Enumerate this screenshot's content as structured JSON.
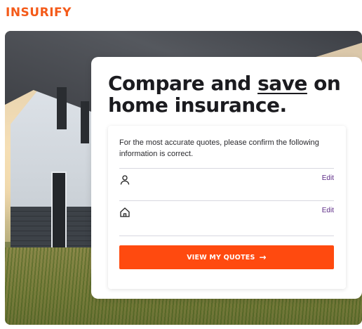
{
  "brand": {
    "logo_text": "INSURIFY",
    "color": "#f45a19"
  },
  "hero": {
    "image": "house-photo"
  },
  "card": {
    "title_part1": "Compare and ",
    "title_emph": "save",
    "title_part2": " on home insurance."
  },
  "form": {
    "intro": "For the most accurate quotes, please confirm the following information is correct.",
    "rows": [
      {
        "icon": "person-icon",
        "edit_label": "Edit"
      },
      {
        "icon": "house-icon",
        "edit_label": "Edit"
      }
    ],
    "cta_label": "VIEW MY QUOTES",
    "cta_icon": "arrow-right-icon",
    "cta_color": "#ff4a0f",
    "edit_color": "#5b2a86"
  }
}
